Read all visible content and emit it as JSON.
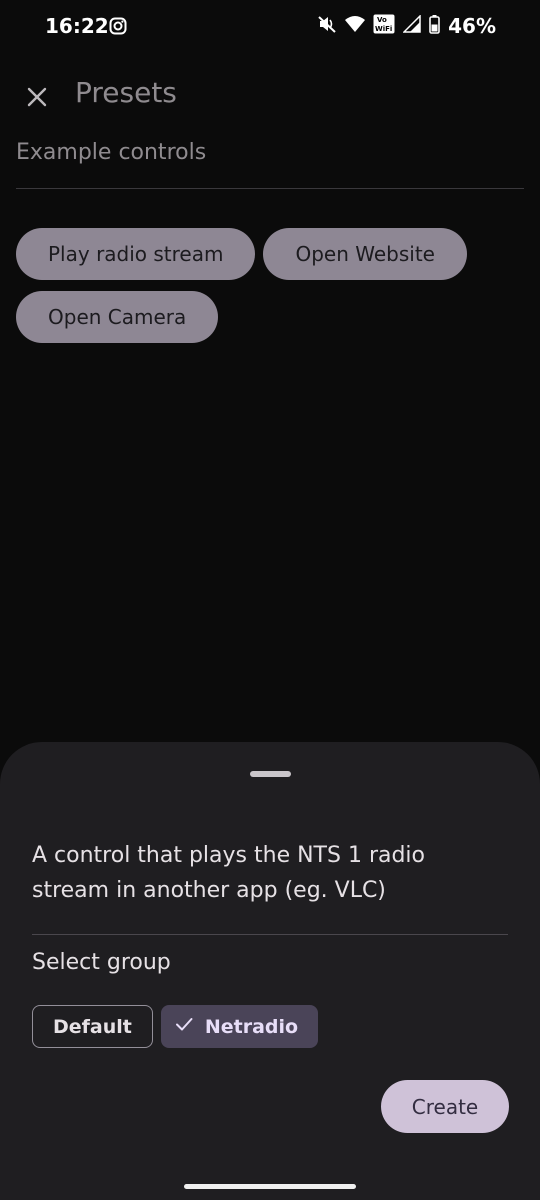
{
  "status_bar": {
    "time": "16:22",
    "battery": "46%",
    "icons": [
      "instagram-icon",
      "mute-icon",
      "wifi-icon",
      "vowifi-icon",
      "signal-icon",
      "battery-icon"
    ],
    "vowifi_top": "Vo",
    "vowifi_bottom": "WiFi"
  },
  "top_bar": {
    "title": "Presets",
    "close_icon": "close-icon"
  },
  "main": {
    "section_label": "Example controls",
    "chips": [
      "Play radio stream",
      "Open Website",
      "Open Camera"
    ]
  },
  "sheet": {
    "description": "A control that plays the NTS 1 radio stream in another app (eg. VLC)",
    "group_label": "Select group",
    "groups": {
      "default_label": "Default",
      "selected_label": "Netradio"
    },
    "create_label": "Create"
  },
  "colors": {
    "background": "#0b0b0b",
    "chip": "#8e8794",
    "sheet": "#1f1e21",
    "selected_chip": "#4a4458",
    "primary_button": "#cfc2d8"
  }
}
